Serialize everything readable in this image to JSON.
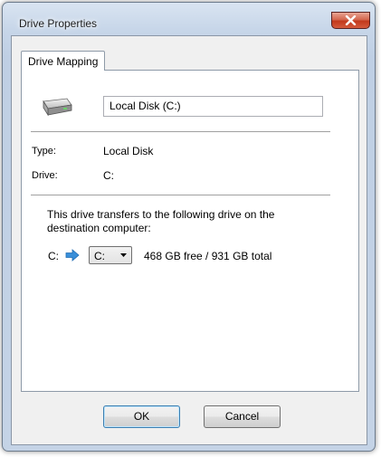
{
  "window": {
    "title": "Drive Properties"
  },
  "tab": {
    "label": "Drive Mapping"
  },
  "drive": {
    "name_field_value": "Local Disk (C:)",
    "type_label": "Type:",
    "type_value": "Local Disk",
    "drive_label": "Drive:",
    "drive_value": "C:"
  },
  "mapping": {
    "description": "This drive transfers to the following drive on the destination computer:",
    "source_letter": "C:",
    "target_selected": "C:",
    "space_info": "468 GB free / 931 GB total"
  },
  "buttons": {
    "ok_label": "OK",
    "cancel_label": "Cancel"
  },
  "icons": {
    "drive": "hard-drive-icon",
    "arrow": "arrow-right-icon",
    "close": "close-icon",
    "dropdown": "chevron-down-icon"
  },
  "colors": {
    "arrow_blue": "#3a8fd9",
    "close_red": "#c2391c",
    "ok_border": "#3c7fb1"
  }
}
